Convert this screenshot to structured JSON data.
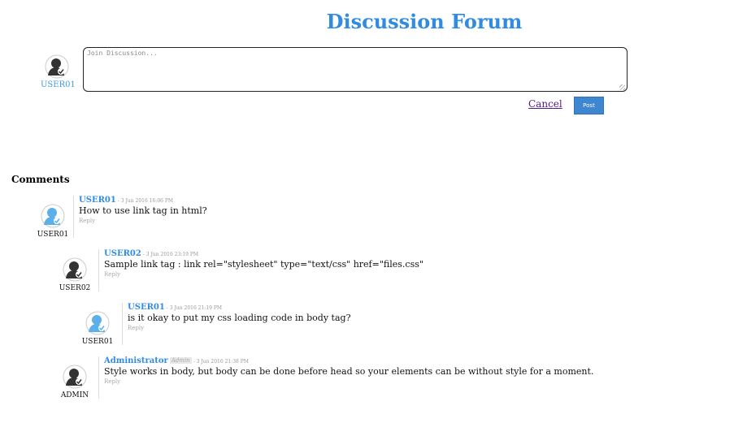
{
  "header": {
    "title": "Discussion Forum"
  },
  "composer": {
    "username": "USER01",
    "placeholder": "Join Discussion...",
    "cancel_label": "Cancel",
    "post_label": "Post"
  },
  "comments_heading": "Comments",
  "comments": [
    {
      "name": "USER01",
      "badge": "",
      "time": "- 3 Jun 2016 16:06 PM",
      "text": "How to use link tag in html?",
      "reply_label": "Reply",
      "author_label": "USER01",
      "avatar_style": "blue"
    },
    {
      "name": "USER02",
      "badge": "",
      "time": "- 3 Jun 2016 23:19 PM",
      "text": "Sample link tag : link rel=\"stylesheet\" type=\"text/css\" href=\"files.css\"",
      "reply_label": "Reply",
      "author_label": "USER02",
      "avatar_style": "dark"
    },
    {
      "name": "USER01",
      "badge": "",
      "time": "- 3 Jun 2016 21:19 PM",
      "text": "is it okay to put my css loading code in body tag?",
      "reply_label": "Reply",
      "author_label": "USER01",
      "avatar_style": "blue"
    },
    {
      "name": "Administrator",
      "badge": "Admin",
      "time": "- 3 Jun 2016 21:38 PM",
      "text": "Style works in body, but body can be done before head so your elements can be without style for a moment.",
      "reply_label": "Reply",
      "author_label": "ADMIN",
      "avatar_style": "dark"
    }
  ],
  "colors": {
    "accent": "#2f8ce0",
    "post_button": "#3f86d1",
    "avatar_dark": "#333333",
    "avatar_blue": "#5bb0ea"
  },
  "icons": {
    "avatar": "user-avatar-icon"
  }
}
